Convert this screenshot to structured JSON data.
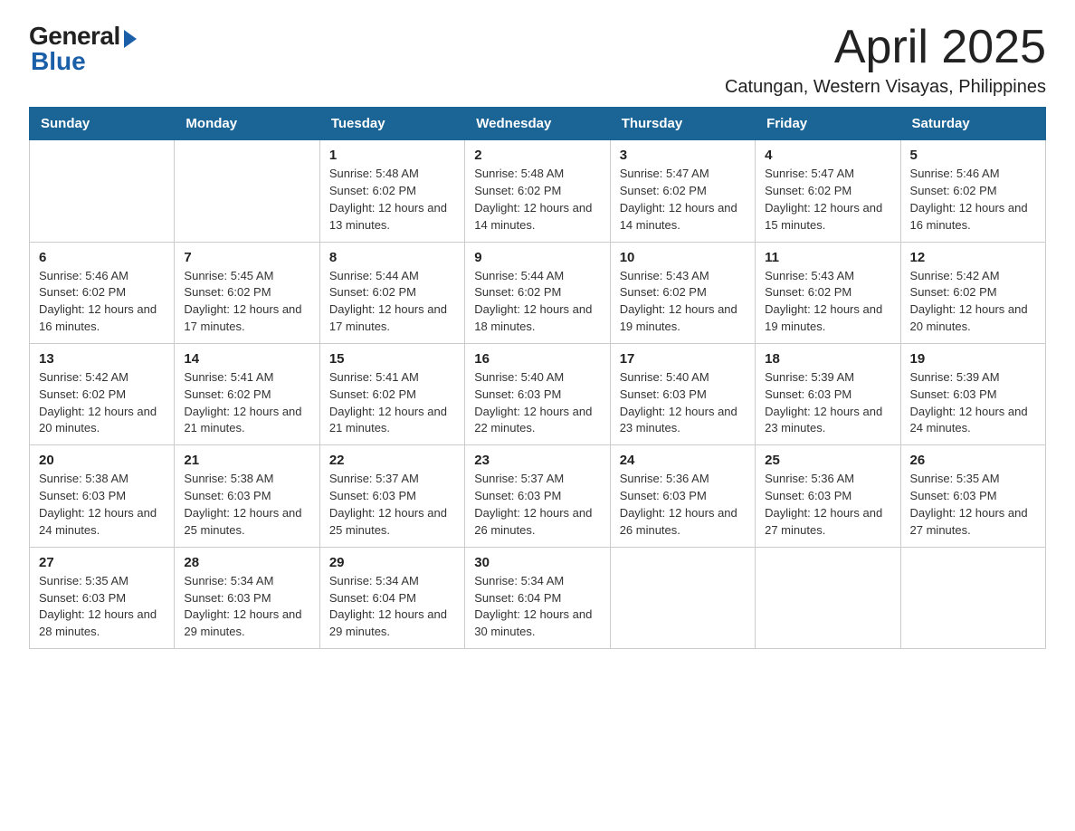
{
  "logo": {
    "general": "General",
    "blue": "Blue"
  },
  "title": {
    "month_year": "April 2025",
    "location": "Catungan, Western Visayas, Philippines"
  },
  "calendar": {
    "headers": [
      "Sunday",
      "Monday",
      "Tuesday",
      "Wednesday",
      "Thursday",
      "Friday",
      "Saturday"
    ],
    "weeks": [
      [
        {
          "day": "",
          "info": ""
        },
        {
          "day": "",
          "info": ""
        },
        {
          "day": "1",
          "info": "Sunrise: 5:48 AM\nSunset: 6:02 PM\nDaylight: 12 hours\nand 13 minutes."
        },
        {
          "day": "2",
          "info": "Sunrise: 5:48 AM\nSunset: 6:02 PM\nDaylight: 12 hours\nand 14 minutes."
        },
        {
          "day": "3",
          "info": "Sunrise: 5:47 AM\nSunset: 6:02 PM\nDaylight: 12 hours\nand 14 minutes."
        },
        {
          "day": "4",
          "info": "Sunrise: 5:47 AM\nSunset: 6:02 PM\nDaylight: 12 hours\nand 15 minutes."
        },
        {
          "day": "5",
          "info": "Sunrise: 5:46 AM\nSunset: 6:02 PM\nDaylight: 12 hours\nand 16 minutes."
        }
      ],
      [
        {
          "day": "6",
          "info": "Sunrise: 5:46 AM\nSunset: 6:02 PM\nDaylight: 12 hours\nand 16 minutes."
        },
        {
          "day": "7",
          "info": "Sunrise: 5:45 AM\nSunset: 6:02 PM\nDaylight: 12 hours\nand 17 minutes."
        },
        {
          "day": "8",
          "info": "Sunrise: 5:44 AM\nSunset: 6:02 PM\nDaylight: 12 hours\nand 17 minutes."
        },
        {
          "day": "9",
          "info": "Sunrise: 5:44 AM\nSunset: 6:02 PM\nDaylight: 12 hours\nand 18 minutes."
        },
        {
          "day": "10",
          "info": "Sunrise: 5:43 AM\nSunset: 6:02 PM\nDaylight: 12 hours\nand 19 minutes."
        },
        {
          "day": "11",
          "info": "Sunrise: 5:43 AM\nSunset: 6:02 PM\nDaylight: 12 hours\nand 19 minutes."
        },
        {
          "day": "12",
          "info": "Sunrise: 5:42 AM\nSunset: 6:02 PM\nDaylight: 12 hours\nand 20 minutes."
        }
      ],
      [
        {
          "day": "13",
          "info": "Sunrise: 5:42 AM\nSunset: 6:02 PM\nDaylight: 12 hours\nand 20 minutes."
        },
        {
          "day": "14",
          "info": "Sunrise: 5:41 AM\nSunset: 6:02 PM\nDaylight: 12 hours\nand 21 minutes."
        },
        {
          "day": "15",
          "info": "Sunrise: 5:41 AM\nSunset: 6:02 PM\nDaylight: 12 hours\nand 21 minutes."
        },
        {
          "day": "16",
          "info": "Sunrise: 5:40 AM\nSunset: 6:03 PM\nDaylight: 12 hours\nand 22 minutes."
        },
        {
          "day": "17",
          "info": "Sunrise: 5:40 AM\nSunset: 6:03 PM\nDaylight: 12 hours\nand 23 minutes."
        },
        {
          "day": "18",
          "info": "Sunrise: 5:39 AM\nSunset: 6:03 PM\nDaylight: 12 hours\nand 23 minutes."
        },
        {
          "day": "19",
          "info": "Sunrise: 5:39 AM\nSunset: 6:03 PM\nDaylight: 12 hours\nand 24 minutes."
        }
      ],
      [
        {
          "day": "20",
          "info": "Sunrise: 5:38 AM\nSunset: 6:03 PM\nDaylight: 12 hours\nand 24 minutes."
        },
        {
          "day": "21",
          "info": "Sunrise: 5:38 AM\nSunset: 6:03 PM\nDaylight: 12 hours\nand 25 minutes."
        },
        {
          "day": "22",
          "info": "Sunrise: 5:37 AM\nSunset: 6:03 PM\nDaylight: 12 hours\nand 25 minutes."
        },
        {
          "day": "23",
          "info": "Sunrise: 5:37 AM\nSunset: 6:03 PM\nDaylight: 12 hours\nand 26 minutes."
        },
        {
          "day": "24",
          "info": "Sunrise: 5:36 AM\nSunset: 6:03 PM\nDaylight: 12 hours\nand 26 minutes."
        },
        {
          "day": "25",
          "info": "Sunrise: 5:36 AM\nSunset: 6:03 PM\nDaylight: 12 hours\nand 27 minutes."
        },
        {
          "day": "26",
          "info": "Sunrise: 5:35 AM\nSunset: 6:03 PM\nDaylight: 12 hours\nand 27 minutes."
        }
      ],
      [
        {
          "day": "27",
          "info": "Sunrise: 5:35 AM\nSunset: 6:03 PM\nDaylight: 12 hours\nand 28 minutes."
        },
        {
          "day": "28",
          "info": "Sunrise: 5:34 AM\nSunset: 6:03 PM\nDaylight: 12 hours\nand 29 minutes."
        },
        {
          "day": "29",
          "info": "Sunrise: 5:34 AM\nSunset: 6:04 PM\nDaylight: 12 hours\nand 29 minutes."
        },
        {
          "day": "30",
          "info": "Sunrise: 5:34 AM\nSunset: 6:04 PM\nDaylight: 12 hours\nand 30 minutes."
        },
        {
          "day": "",
          "info": ""
        },
        {
          "day": "",
          "info": ""
        },
        {
          "day": "",
          "info": ""
        }
      ]
    ]
  }
}
